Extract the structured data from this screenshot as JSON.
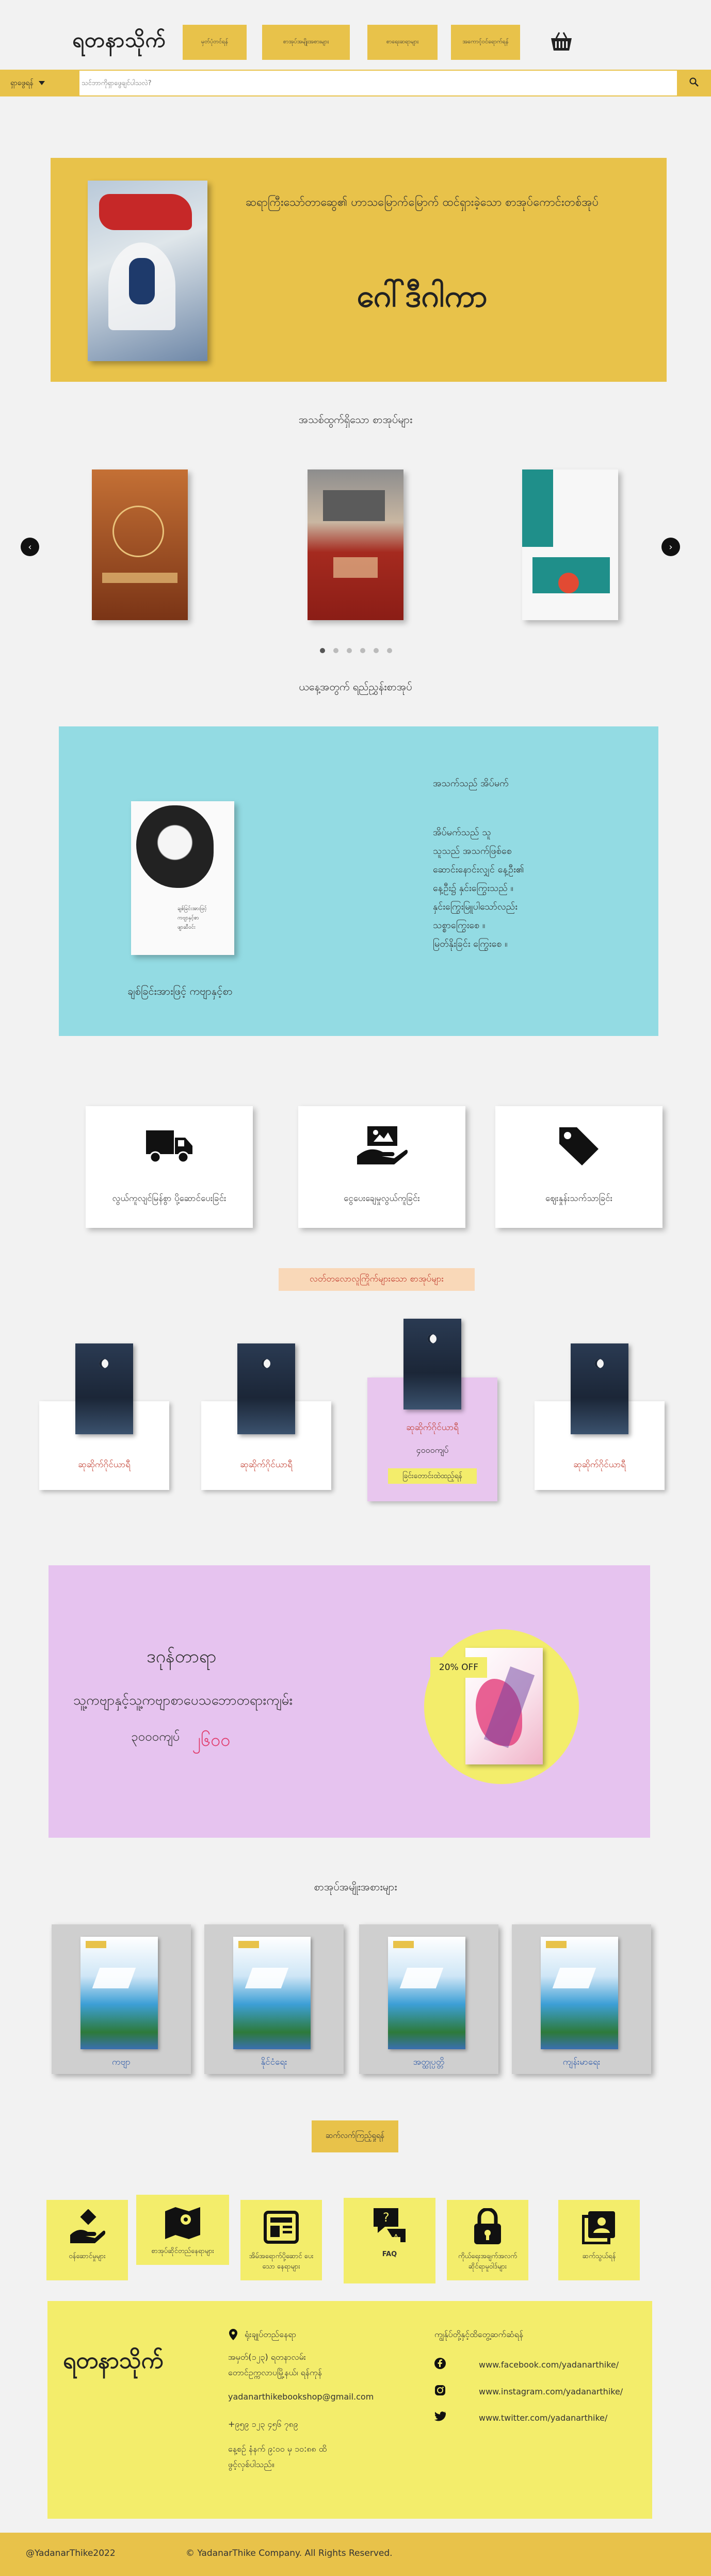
{
  "header": {
    "logo": "ရတနာသိုက်",
    "nav": [
      "မှတ်ပုံတင်ရန်",
      "စာအုပ်အမျိုးအစားများ",
      "စာရေးဆရာများ",
      "အကောင့်ဝင်ရောက်ရန်"
    ],
    "basket_icon": "basket-icon"
  },
  "search": {
    "category_label": "ရှာဖွေရန်",
    "placeholder": "သင်ဘာကိုရှာဖွေချင်ပါသလဲ?",
    "search_icon": "search-icon"
  },
  "hero": {
    "subtitle": "ဆရာကြီးသော်တာဆွေ၏ ဟာသမြောက်မြောက် ထင်ရှားခဲ့သော စာအုပ်ကောင်းတစ်အုပ်",
    "title": "ဂေါ်ဒီဂါကာ"
  },
  "carousel": {
    "title": "အသစ်ထွက်ရှိသော စာအုပ်များ",
    "books": [
      {
        "name": "the-secret-cover",
        "color": "#b0582a"
      },
      {
        "name": "the-jungle-cover",
        "color": "#a83a2c"
      },
      {
        "name": "minimalism-cover",
        "color": "#1f8f8a"
      }
    ],
    "dots": 6,
    "active_dot": 0
  },
  "daily": {
    "title": "ယနေ့အတွက် ရည်ညွှန်းစာအုပ်",
    "author": "ချစ်ခြင်းအားဖြင့် ကဗျာနှင့်စာ",
    "poem_title": "အသက်သည် အိပ်မက်",
    "poem": "အိပ်မက်သည် သူ\nသူသည် အသက်ဖြစ်စေ\nဆောင်းနောင်းလျှင် နေ့ဦး၏\nနေ့ဦး၌ နှင်းကြွေးသည် ။\nနှင်းကြွေးမြူပါသော်လည်း\nသစ္စာကြွေးစေ ။\nမြတ်နိုးခြင်း ကြွေးစေ ။"
  },
  "services": [
    {
      "icon": "delivery-truck-icon",
      "label": "လွယ်ကူလျင်မြန်စွာ ပို့ဆောင်ပေးခြင်း"
    },
    {
      "icon": "payment-hand-icon",
      "label": "ငွေပေးချေမှုလွယ်ကူခြင်း"
    },
    {
      "icon": "price-tag-icon",
      "label": "ဈေးနှုန်းသက်သာခြင်း"
    }
  ],
  "promo": {
    "title": "လတ်တလောလူကြိုက်များသော စာအုပ်များ",
    "products": [
      {
        "name": "ဆုဆိုက်ဂိုင်ယာရီ",
        "price": "",
        "cta": ""
      },
      {
        "name": "ဆုဆိုက်ဂိုင်ယာရီ",
        "price": "",
        "cta": ""
      },
      {
        "name": "ဆုဆိုက်ဂိုင်ယာရီ",
        "price": "၄၀၀၀ကျပ်",
        "cta": "ခြင်းတောင်းထဲထည့်ရန်"
      },
      {
        "name": "ဆုဆိုက်ဂိုင်ယာရီ",
        "price": "",
        "cta": ""
      }
    ]
  },
  "discount": {
    "heading": "ဒဂုန်တာရာ",
    "description": "သူ့ကဗျာနှင့်သူ့ကဗျာစာပေသဘောတရားကျမ်း",
    "old_price": "၃၀၀၀ကျပ်",
    "new_price": "၂၆၀၀",
    "badge": "20% OFF"
  },
  "categories": {
    "title": "စာအုပ်အမျိုးအစားများ",
    "items": [
      "ကဗျာ",
      "နိုင်ငံရေး",
      "အတ္ထုပ္ပတ္တိ",
      "ကျန်းမာရေး"
    ],
    "more_button": "ဆက်လက်ကြည့်ရှုရန်"
  },
  "info_links": [
    {
      "icon": "service-hand-icon",
      "label": "ဝန်ဆောင်မှုများ"
    },
    {
      "icon": "map-location-icon",
      "label": "စာအုပ်ဆိုင်တည်နေရာများ"
    },
    {
      "icon": "newspaper-icon",
      "label": "အိမ်အရောက်ပို့ဆောင် ပေးသော နေရာများ"
    },
    {
      "icon": "faq-icon",
      "label": "FAQ"
    },
    {
      "icon": "lock-icon",
      "label": "ကိုယ်ရေးအချက်အလက် ဆိုင်ရာမူဝါဒ်များ"
    },
    {
      "icon": "contact-card-icon",
      "label": "ဆက်သွယ်ရန်"
    }
  ],
  "footer": {
    "logo": "ရတနာသိုက်",
    "location_label": "ရုံးချုပ်တည်နေရာ",
    "address": "အမှတ်(၁၂၃) ရတနာလမ်း\nတောင်ဥက္ကလာပမြို့နယ်၊ ရန်ကုန်",
    "email": "yadanarthikebookshop@gmail.com",
    "phone": "+၉၅၉ ၁၂၃ ၄၅၆ ၇၈၉",
    "hours": "နေ့စဉ် နံနက် ၉:၀၀ မှ ၁၀:၈၈ ထိ\nဖွင့်လှစ်ပါသည်။",
    "social_title": "ကျွန်ုပ်တို့နှင့်ထိတွေ့ဆက်ဆံရန်",
    "social": [
      {
        "icon": "facebook-icon",
        "url": "www.facebook.com/yadanarthike/"
      },
      {
        "icon": "instagram-icon",
        "url": "www.instagram.com/yadanarthike/"
      },
      {
        "icon": "twitter-icon",
        "url": "www.twitter.com/yadanarthike/"
      }
    ]
  },
  "bottom": {
    "handle": "@YadanarThike2022",
    "copyright": "© YadanarThike Company. All Rights Reserved."
  },
  "colors": {
    "accent": "#e8c24a",
    "light_yellow": "#f3ed6b",
    "daily_bg": "#93dbe3",
    "discount_bg": "#e6c3ef",
    "price_red": "#e03a6a"
  }
}
